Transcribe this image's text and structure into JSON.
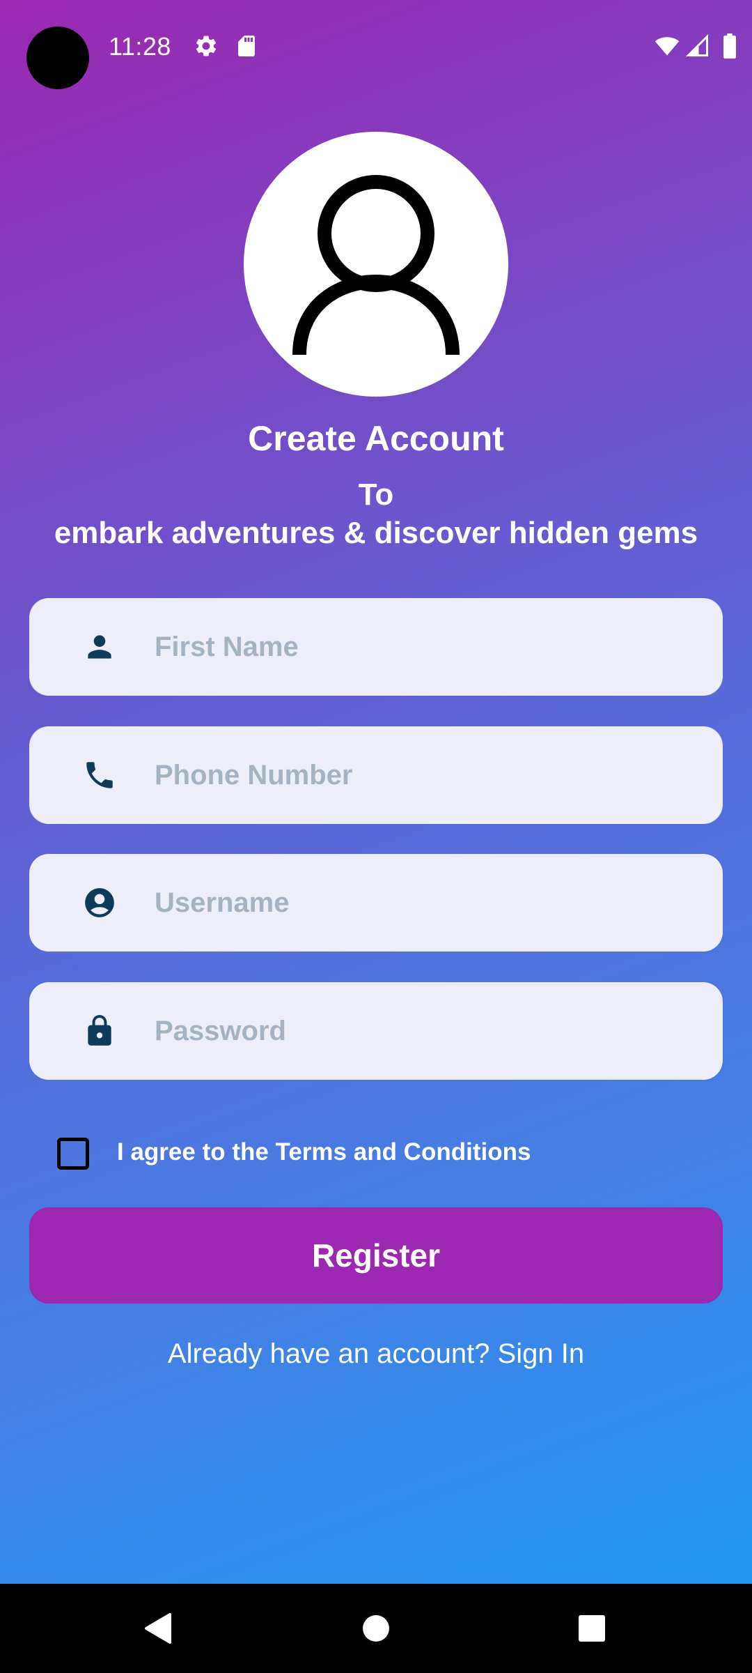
{
  "status_bar": {
    "time": "11:28",
    "icons": [
      "camera-dot",
      "gear-icon",
      "sd-card-icon",
      "wifi-icon",
      "signal-icon",
      "battery-icon"
    ]
  },
  "avatar": {
    "icon": "person-outline-icon"
  },
  "header": {
    "title": "Create Account",
    "subtitle_line1": "To",
    "subtitle_line2": "embark adventures & discover hidden gems"
  },
  "form": {
    "first_name": {
      "placeholder": "First Name",
      "value": "",
      "icon": "person-icon"
    },
    "phone": {
      "placeholder": "Phone Number",
      "value": "",
      "icon": "phone-icon"
    },
    "username": {
      "placeholder": "Username",
      "value": "",
      "icon": "account-circle-icon"
    },
    "password": {
      "placeholder": "Password",
      "value": "",
      "icon": "lock-icon"
    }
  },
  "terms": {
    "label": "I agree to the Terms and Conditions",
    "checked": false
  },
  "register_label": "Register",
  "signin_text": "Already have an account? Sign In",
  "nav": {
    "icons": [
      "back-icon",
      "home-icon",
      "recents-icon"
    ]
  },
  "colors": {
    "gradient_start": "#9c27b0",
    "gradient_end": "#2196f3",
    "button": "#9c27b0",
    "field_bg": "#eeeefa",
    "icon": "#0d3b5a",
    "placeholder": "#a4b3c4"
  }
}
